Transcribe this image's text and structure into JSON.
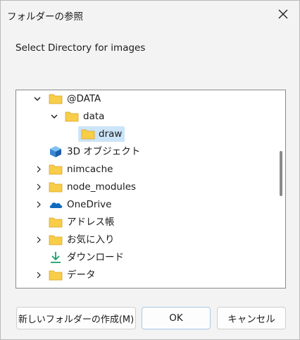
{
  "window": {
    "title": "フォルダーの参照"
  },
  "description": "Select Directory for images",
  "tree": {
    "items": [
      {
        "label": "@DATA",
        "expander": "expanded",
        "icon": "folder-icon"
      },
      {
        "label": "data",
        "expander": "expanded",
        "icon": "folder-icon"
      },
      {
        "label": "draw",
        "expander": "none",
        "icon": "folder-icon",
        "selected": true
      },
      {
        "label": "3D オブジェクト",
        "expander": "none",
        "icon": "3d-objects-icon"
      },
      {
        "label": "nimcache",
        "expander": "collapsed",
        "icon": "folder-icon"
      },
      {
        "label": "node_modules",
        "expander": "collapsed",
        "icon": "folder-icon"
      },
      {
        "label": "OneDrive",
        "expander": "collapsed",
        "icon": "onedrive-cloud-icon"
      },
      {
        "label": "アドレス帳",
        "expander": "none",
        "icon": "folder-icon"
      },
      {
        "label": "お気に入り",
        "expander": "collapsed",
        "icon": "folder-icon"
      },
      {
        "label": "ダウンロード",
        "expander": "none",
        "icon": "download-arrow-icon"
      },
      {
        "label": "データ",
        "expander": "collapsed",
        "icon": "folder-icon"
      }
    ]
  },
  "buttons": {
    "new_folder": "新しいフォルダーの作成(M)",
    "ok": "OK",
    "cancel": "キャンセル"
  },
  "colors": {
    "folder": "#f8cd48",
    "selection": "#cce4f7",
    "download": "#1aa06d",
    "onedrive": "#0f6cbd",
    "cube": "#3a86d4"
  }
}
